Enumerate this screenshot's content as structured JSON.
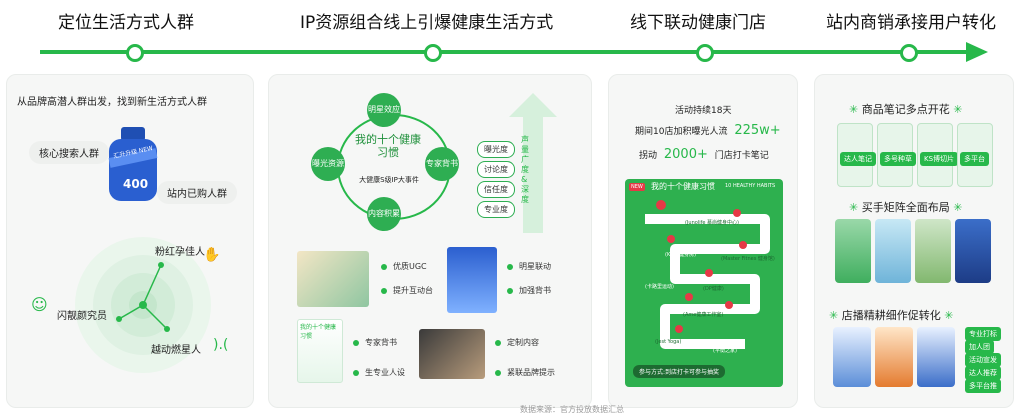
{
  "timeline": {
    "stages": [
      {
        "title": "定位生活方式人群"
      },
      {
        "title": "IP资源组合线上引爆健康生活方式"
      },
      {
        "title": "线下联动健康门店"
      },
      {
        "title": "站内商销承接用户转化"
      }
    ]
  },
  "panel1": {
    "heading": "从品牌高潜人群出发，找到新生活方式人群",
    "product_badge": "400",
    "product_ribbon": "汇升升级 NEW",
    "audiences": [
      "核心搜索人群",
      "站内已购人群",
      "粉红孕佳人",
      "闪靓颜究员",
      "越动燃星人"
    ]
  },
  "panel2": {
    "center_title": "我的十个健康习惯",
    "center_sub": "大健康S级IP大事件",
    "nodes": [
      "明星效应",
      "曝光资源",
      "专家背书",
      "内容积累"
    ],
    "degree_tags": [
      "曝光度",
      "讨论度",
      "信任度",
      "专业度"
    ],
    "arrow_text": "声量广度&深度",
    "rows": [
      [
        "优质UGC",
        "明星联动"
      ],
      [
        "提升互动台",
        "加强背书"
      ],
      [
        "专家背书",
        "定制内容"
      ],
      [
        "生专业人设",
        "紧联品牌提示"
      ]
    ],
    "thumb_title": "我的十个健康习惯"
  },
  "panel3": {
    "line1": "活动持续18天",
    "line2_label": "期间10店加积曝光人流",
    "line2_value": "225w+",
    "line3_label": "拐动",
    "line3_value": "2000+",
    "line3_suffix": "门店打卡笔记",
    "map_title": "我的十个健康习惯",
    "map_en": "10 HEALTHY HABITS",
    "map_labels": [
      "(Junolife 慕尚健身中心)",
      "(Master Fitnes 健身馆)",
      "(K&B 健身房)",
      "(DP健康)",
      "(Ame健康工作室)",
      "(Jest Yoga)",
      "(卡路里运动)",
      "(平衡之家)"
    ],
    "map_footer": "参与方式:到店打卡可参与抽奖"
  },
  "panel4": {
    "sections": [
      {
        "title": "商品笔记多点开花",
        "items": [
          "达人笔记",
          "多号种草",
          "KS博切片",
          "多平台"
        ]
      },
      {
        "title": "买手矩阵全面布局",
        "items": [
          "",
          "",
          "",
          ""
        ]
      },
      {
        "title": "店播精耕细作促转化",
        "buttons": [
          "专业打标",
          "加人团",
          "活动宣发",
          "达人推荐",
          "多平台推"
        ]
      }
    ]
  },
  "colors": {
    "accent": "#27b84a",
    "accent_dark": "#1d8f39",
    "panel_bg": "#f6f7f6"
  },
  "footer_cut": "数据来源：官方投放数据汇总"
}
